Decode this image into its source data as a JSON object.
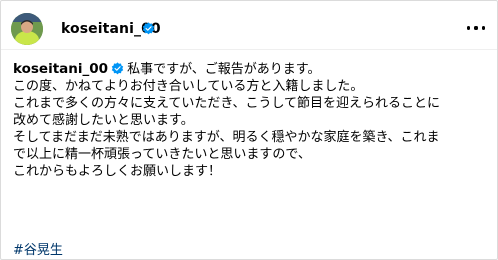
{
  "header": {
    "username": "koseitani_00"
  },
  "caption": {
    "username": "koseitani_00",
    "intro": "私事ですが、ご報告があります。",
    "paragraph1": [
      "この度、かねてよりお付き合いしている方と入籍しました。",
      "これまで多くの方々に支えていただき、こうして節目を迎えられることに",
      "改めて感謝したいと思います。"
    ],
    "paragraph2": [
      "そしてまだまだ未熟ではありますが、明るく穏やかな家庭を築き、これま",
      "で以上に精一杯頑張っていきたいと思いますので、",
      "これからもよろしくお願いします！"
    ],
    "hashtag": "#谷晃生"
  },
  "icons": {
    "verified": "verified-badge-icon",
    "more": "more-options-icon"
  },
  "colors": {
    "verified": "#0095f6",
    "hashtag": "#00376b"
  }
}
